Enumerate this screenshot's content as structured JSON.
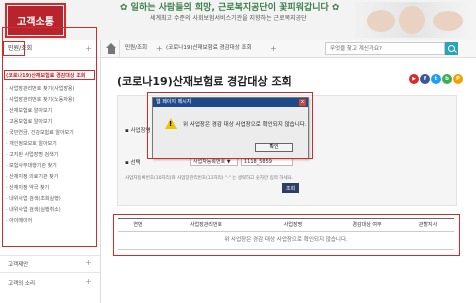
{
  "colors": {
    "brand": "#b9242c",
    "accent": "#2aa4b8",
    "highlight": "#d42a2a",
    "dialog_title_bg": "#1f4a8a",
    "button_dark": "#2c3f63"
  },
  "header": {
    "brand": "고객소통",
    "slogan": "✿ 일하는 사람들의 희망, 근로복지공단이 꽃피워갑니다 ✿",
    "subslogan": "세계최고 수준의 사회보험서비스기관을 지향하는 근로복지공단"
  },
  "topbar": {
    "crumbs": [
      "민원/조회",
      "(코로나19)산재보험료 경감대상 조회"
    ],
    "search_placeholder": "무엇을 찾고 계신가요?"
  },
  "sidebar": {
    "header": "민원/조회",
    "items": [
      "(코로나19)산재보험료 경감대상 조회",
      "· 사업장관리번호 찾기(사업장용)",
      "· 사업장관리번호 찾기(노동자용)",
      "· 산재보험료 알아보기",
      "· 고용보험료 알아보기",
      "· 국민연금, 건강보험료 알아보기",
      "· 개인정보보호 알아보기",
      "· 고지된 사업장명 검색기",
      "· 보험사무대행기관 찾기",
      "· 산재지정 의료기관 찾기",
      "· 산재지정 약국 찾기",
      "· 내위사업 검색(조회실행)",
      "· 내위사업 검색(실행취소)",
      "· 아이메이어"
    ],
    "bottom": [
      "고객제안",
      "고객의 소리"
    ]
  },
  "main": {
    "title": "(코로나19)산재보험료 경감대상 조회",
    "sns": [
      "▶",
      "f",
      "t",
      "b",
      "P"
    ],
    "label_workplace": "▪ 사업장명",
    "label_select": "▪ 선택",
    "select_value": "사업자등록번호 ▼",
    "number_value": "1118_5859",
    "hint": "사업자등록번호(10자리)와 사업장관리번호(11자리) \"-\" 는 생략하고 숫자만 입력 하세요.",
    "query_button": "조회"
  },
  "dialog": {
    "title": "웹 페이지 메시지",
    "close": "x",
    "message": "위 사업장은 경감 대상 사업장으로 확인되지 않습니다.",
    "ok": "확인"
  },
  "grid": {
    "columns": [
      "연번",
      "사업장관리번호",
      "사업장명",
      "경감대상 여부",
      "관할지사"
    ],
    "empty": "위 사업장은 경감 대상 사업장으로 확인되지 않습니다."
  }
}
